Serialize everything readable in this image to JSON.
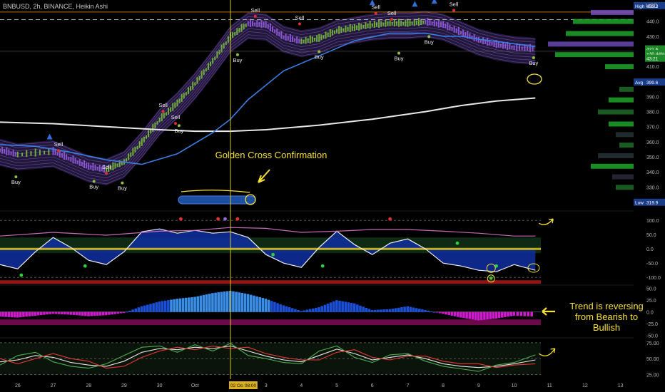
{
  "header": {
    "symbol_info": "BNBUSD, 2h, BINANCE, Heikin Ashi",
    "currency": "USD"
  },
  "annotations": {
    "golden_cross": "Golden Cross Confirmation",
    "trend_reversal": "Trend is reversing from Bearish to Bullish"
  },
  "colors": {
    "background": "#000000",
    "annotation": "#f5e13a",
    "slow_ma": "#e8e8e8",
    "mid_ma": "#3c7ee6",
    "ribbon": "#9a68d6",
    "buy_marker": "#8fbf3e",
    "sell_marker": "#e03030",
    "triangle": "#2f6fdc",
    "crosshair": "#d8c53a"
  },
  "chart_data": [
    {
      "type": "line",
      "title": "BNBUSD, 2h, BINANCE, Heikin Ashi",
      "x_ticks": [
        "26",
        "27",
        "28",
        "29",
        "30",
        "Oct",
        "02 Oct '21",
        "08:00",
        "3",
        "4",
        "5",
        "6",
        "7",
        "8",
        "9",
        "10",
        "11",
        "12",
        "13"
      ],
      "x_tick_pos": [
        1,
        2,
        3,
        4,
        5,
        6,
        7,
        7.4,
        8,
        9,
        10,
        11,
        12,
        13,
        14,
        15,
        16,
        17,
        18
      ],
      "xlim": [
        0.5,
        18.5
      ],
      "crosshair_x": 7,
      "ylim": [
        316,
        454
      ],
      "y_ticks": [
        330,
        340,
        350,
        360,
        370,
        380,
        390,
        410,
        420,
        430,
        440
      ],
      "y_badges": [
        {
          "label": "High",
          "value": "450.3"
        },
        {
          "label": "",
          "value": "421.6"
        },
        {
          "label": "",
          "value": "+30.44%"
        },
        {
          "label": "",
          "value": "43:21"
        },
        {
          "label": "Avg",
          "value": "399.6"
        },
        {
          "label": "Low",
          "value": "319.9"
        }
      ],
      "signals": [
        {
          "text": "Buy",
          "x": 0.95,
          "y": 332
        },
        {
          "text": "Sell",
          "x": 2.15,
          "y": 357
        },
        {
          "text": "Sell",
          "x": 3.5,
          "y": 342
        },
        {
          "text": "Buy",
          "x": 3.15,
          "y": 329
        },
        {
          "text": "Buy",
          "x": 3.95,
          "y": 328
        },
        {
          "text": "Sell",
          "x": 5.1,
          "y": 383
        },
        {
          "text": "Sell",
          "x": 5.45,
          "y": 375
        },
        {
          "text": "Buy",
          "x": 5.55,
          "y": 366
        },
        {
          "text": "Buy",
          "x": 7.2,
          "y": 413
        },
        {
          "text": "Sell",
          "x": 7.7,
          "y": 446
        },
        {
          "text": "Sell",
          "x": 8.95,
          "y": 441
        },
        {
          "text": "Buy",
          "x": 9.5,
          "y": 415
        },
        {
          "text": "Sell",
          "x": 11.1,
          "y": 448
        },
        {
          "text": "Sell",
          "x": 11.55,
          "y": 444
        },
        {
          "text": "Buy",
          "x": 11.75,
          "y": 414
        },
        {
          "text": "Buy",
          "x": 12.6,
          "y": 425
        },
        {
          "text": "Sell",
          "x": 13.3,
          "y": 450
        },
        {
          "text": "Buy",
          "x": 15.55,
          "y": 411
        }
      ],
      "series": [
        {
          "name": "",
          "color": "#e8e8e8",
          "x": [
            0.5,
            2,
            3.5,
            5,
            6,
            7,
            8,
            9.5,
            11,
            12.5,
            13.5,
            14.5,
            15.6
          ],
          "y": [
            373,
            372,
            370,
            368,
            367,
            367,
            368,
            371,
            375,
            380,
            384,
            387,
            389
          ]
        },
        {
          "name": "",
          "color": "#3c7ee6",
          "x": [
            0.5,
            1.5,
            2.5,
            3.5,
            4.5,
            5.5,
            6.5,
            7,
            7.5,
            8.5,
            9.5,
            10.5,
            11.5,
            12.5,
            13,
            13.5,
            14,
            15,
            15.6
          ],
          "y": [
            358,
            357,
            353,
            348,
            345,
            352,
            366,
            375,
            388,
            407,
            417,
            427,
            432,
            432,
            430,
            430,
            428,
            425,
            423
          ]
        },
        {
          "name": "",
          "color": "#9a68d6",
          "x": [
            0.5,
            1,
            2,
            2.5,
            3,
            3.5,
            4,
            4.5,
            5,
            5.5,
            6,
            6.5,
            7,
            7.5,
            8,
            8.5,
            9,
            9.5,
            10,
            10.5,
            11,
            11.5,
            12,
            12.5,
            13,
            13.5,
            14,
            14.5,
            15,
            15.6
          ],
          "y": [
            353,
            350,
            352,
            347,
            342,
            340,
            345,
            358,
            373,
            384,
            397,
            412,
            428,
            437,
            436,
            428,
            425,
            427,
            432,
            434,
            436,
            437,
            437,
            438,
            436,
            431,
            426,
            423,
            421,
            420
          ]
        }
      ]
    },
    {
      "type": "line",
      "title": "",
      "ylim": [
        -122,
        118
      ],
      "y_ticks": [
        "100.0",
        "50.0",
        "0.0",
        "-50.0",
        "-100.0"
      ],
      "y_tick_values": [
        100,
        50,
        0,
        -50,
        -100
      ],
      "series": [
        {
          "name": "",
          "color": "#f0f0f0",
          "x": [
            0.5,
            1,
            1.5,
            2,
            2.5,
            3,
            3.5,
            4,
            4.5,
            5,
            5.5,
            6,
            6.5,
            7,
            7.5,
            8,
            8.5,
            9,
            9.5,
            10,
            10.5,
            11,
            11.5,
            12,
            12.5,
            13,
            13.5,
            14,
            14.5,
            15,
            15.6
          ],
          "y": [
            -55,
            -70,
            -10,
            40,
            5,
            -40,
            -55,
            -10,
            60,
            70,
            55,
            65,
            55,
            60,
            40,
            -20,
            -50,
            -65,
            5,
            62,
            15,
            -20,
            20,
            35,
            0,
            -50,
            -60,
            -75,
            -80,
            -55,
            -75
          ]
        },
        {
          "name": "",
          "color": "#c86ab8",
          "x": [
            0.5,
            2,
            3.5,
            5,
            6,
            7,
            8,
            9,
            10,
            11,
            12,
            13,
            14,
            15,
            15.6
          ],
          "y": [
            45,
            58,
            48,
            62,
            65,
            75,
            72,
            58,
            62,
            68,
            68,
            62,
            55,
            45,
            45
          ]
        }
      ]
    },
    {
      "type": "bar",
      "title": "",
      "ylim": [
        -52,
        60
      ],
      "y_ticks": [
        "50.0",
        "25.0",
        "0.0",
        "-25.0",
        "-50.0"
      ],
      "y_tick_values": [
        50,
        25,
        0,
        -25,
        -50
      ],
      "x": [
        0.5,
        1,
        1.5,
        2,
        2.5,
        3,
        3.5,
        4,
        4.5,
        5,
        5.5,
        6,
        6.5,
        7,
        7.5,
        8,
        8.5,
        9,
        9.5,
        10,
        10.5,
        11,
        11.5,
        12,
        12.5,
        13,
        13.5,
        14,
        14.5,
        15,
        15.6
      ],
      "values": [
        -10,
        -12,
        -8,
        -4,
        -6,
        -9,
        -7,
        -2,
        12,
        22,
        28,
        32,
        40,
        45,
        38,
        28,
        14,
        2,
        10,
        25,
        18,
        4,
        6,
        12,
        4,
        -4,
        -12,
        -18,
        -14,
        -8,
        -10
      ]
    },
    {
      "type": "line",
      "title": "",
      "ylim": [
        20,
        85
      ],
      "y_ticks": [
        "75.00",
        "50.00",
        "25.00"
      ],
      "y_tick_values": [
        75,
        50,
        25
      ],
      "series": [
        {
          "name": "",
          "color": "#e8e8e8",
          "x": [
            0.5,
            1,
            1.5,
            2,
            2.5,
            3,
            3.5,
            4,
            4.5,
            5,
            5.5,
            6,
            6.5,
            7,
            7.5,
            8,
            8.5,
            9,
            9.5,
            10,
            10.5,
            11,
            11.5,
            12,
            12.5,
            13,
            13.5,
            14,
            14.5,
            15,
            15.6
          ],
          "y": [
            45,
            48,
            55,
            52,
            44,
            40,
            38,
            46,
            60,
            66,
            64,
            68,
            66,
            70,
            62,
            54,
            48,
            45,
            55,
            65,
            58,
            48,
            52,
            56,
            50,
            42,
            38,
            36,
            38,
            42,
            48
          ]
        },
        {
          "name": "",
          "color": "#4caf50",
          "x": [
            0.5,
            1,
            1.5,
            2,
            2.5,
            3,
            3.5,
            4,
            4.5,
            5,
            5.5,
            6,
            6.5,
            7,
            7.5,
            8,
            8.5,
            9,
            9.5,
            10,
            10.5,
            11,
            11.5,
            12,
            12.5,
            13,
            13.5,
            14,
            14.5,
            15,
            15.6
          ],
          "y": [
            40,
            55,
            60,
            45,
            38,
            35,
            42,
            55,
            68,
            70,
            60,
            72,
            62,
            74,
            55,
            50,
            44,
            42,
            62,
            70,
            52,
            44,
            56,
            58,
            46,
            38,
            34,
            30,
            40,
            44,
            56
          ]
        },
        {
          "name": "",
          "color": "#e53935",
          "x": [
            0.5,
            1,
            1.5,
            2,
            2.5,
            3,
            3.5,
            4,
            4.5,
            5,
            5.5,
            6,
            6.5,
            7,
            7.5,
            8,
            8.5,
            9,
            9.5,
            10,
            10.5,
            11,
            11.5,
            12,
            12.5,
            13,
            13.5,
            14,
            14.5,
            15,
            15.6
          ],
          "y": [
            50,
            42,
            50,
            58,
            50,
            46,
            35,
            38,
            52,
            62,
            68,
            64,
            70,
            66,
            68,
            58,
            52,
            48,
            48,
            60,
            64,
            52,
            48,
            54,
            54,
            46,
            42,
            42,
            36,
            40,
            42
          ]
        }
      ]
    }
  ]
}
